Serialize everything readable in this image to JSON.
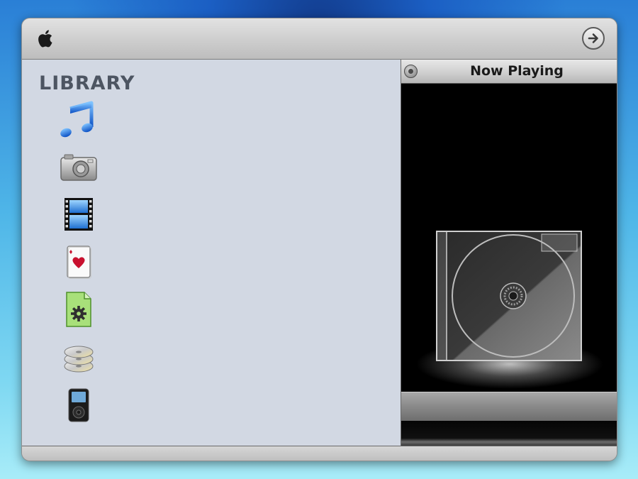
{
  "library": {
    "title": "LIBRARY",
    "items": [
      {
        "icon": "music-note-icon"
      },
      {
        "icon": "camera-icon"
      },
      {
        "icon": "film-strip-icon"
      },
      {
        "icon": "playing-card-icon"
      },
      {
        "icon": "settings-document-icon"
      },
      {
        "icon": "disc-stack-icon"
      },
      {
        "icon": "ipod-icon"
      }
    ]
  },
  "now_playing": {
    "title": "Now Playing",
    "artwork_icon": "cd-case-icon"
  },
  "titlebar": {
    "logo_icon": "apple-logo-icon",
    "forward_icon": "arrow-right-circle-icon"
  },
  "colors": {
    "library_bg": "#d2d8e3",
    "now_playing_bg": "#000000",
    "desktop_accent": "#2a7fd6"
  }
}
